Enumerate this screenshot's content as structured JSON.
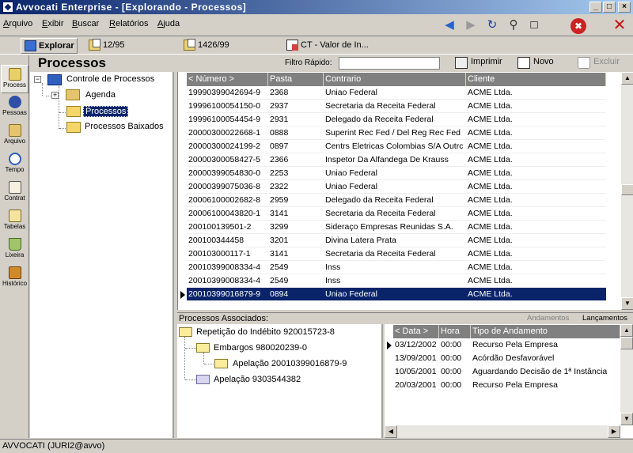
{
  "window": {
    "title": "Avvocati Enterprise - [Explorando - Processos]",
    "controls": [
      "_",
      "□",
      "×"
    ]
  },
  "menu": [
    {
      "label": "Arquivo",
      "u": "A",
      "rest": "rquivo"
    },
    {
      "label": "Exibir",
      "u": "E",
      "rest": "xibir"
    },
    {
      "label": "Buscar",
      "u": "B",
      "rest": "uscar"
    },
    {
      "label": "Relatórios",
      "u": "R",
      "rest": "elatórios"
    },
    {
      "label": "Ajuda",
      "u": "A",
      "rest": "juda"
    }
  ],
  "toolbar_icons": [
    "back-arrow-icon",
    "forward-arrow-icon",
    "refresh-icon",
    "search-icon",
    "new-document-icon",
    "stop-icon",
    "close-icon"
  ],
  "tabs": [
    {
      "label": "Explorar",
      "active": true
    },
    {
      "label": "12/95",
      "active": false
    },
    {
      "label": "1426/99",
      "active": false
    },
    {
      "label": "CT - Valor de In...",
      "active": false
    }
  ],
  "leftnav": [
    {
      "label": "Process",
      "icon": "process-icon",
      "active": true
    },
    {
      "label": "Pessoas",
      "icon": "people-icon",
      "active": false
    },
    {
      "label": "Arquivo",
      "icon": "archive-icon",
      "active": false
    },
    {
      "label": "Tempo",
      "icon": "clock-icon",
      "active": false
    },
    {
      "label": "Contrat",
      "icon": "contract-icon",
      "active": false
    },
    {
      "label": "Tabelas",
      "icon": "table-icon",
      "active": false
    },
    {
      "label": "Lixeira",
      "icon": "trash-icon",
      "active": false
    },
    {
      "label": "Histórico",
      "icon": "history-icon",
      "active": false
    }
  ],
  "panel": {
    "title": "Processos",
    "filter_label": "Filtro Rápido:",
    "filter_value": "",
    "print_label": "Imprimir",
    "new_label": "Novo",
    "delete_label": "Excluir"
  },
  "tree": {
    "root": "Controle de Processos",
    "agenda": "Agenda",
    "processos": "Processos",
    "baixados": "Processos Baixados"
  },
  "grid": {
    "columns": [
      "< Número >",
      "Pasta",
      "Contrario",
      "Cliente"
    ],
    "rows": [
      [
        "19990399042694-9",
        "2368",
        "Uniao Federal",
        "ACME Ltda."
      ],
      [
        "19996100054150-0",
        "2937",
        "Secretaria da Receita Federal",
        "ACME Ltda."
      ],
      [
        "19996100054454-9",
        "2931",
        "Delegado da Receita Federal",
        "ACME Ltda."
      ],
      [
        "20000300022668-1",
        "0888",
        "Superint Rec Fed / Del Reg Rec Fed",
        "ACME Ltda."
      ],
      [
        "20000300024199-2",
        "0897",
        "Centrs Eletricas Colombias S/A Outrc",
        "ACME Ltda."
      ],
      [
        "20000300058427-5",
        "2366",
        "Inspetor Da Alfandega De Krauss",
        "ACME Ltda."
      ],
      [
        "20000399054830-0",
        "2253",
        "Uniao Federal",
        "ACME Ltda."
      ],
      [
        "20000399075036-8",
        "2322",
        "Uniao Federal",
        "ACME Ltda."
      ],
      [
        "20006100002682-8",
        "2959",
        "Delegado da Receita Federal",
        "ACME Ltda."
      ],
      [
        "20006100043820-1",
        "3141",
        "Secretaria da Receita Federal",
        "ACME Ltda."
      ],
      [
        "200100139501-2",
        "3299",
        "Sideraço Empresas Reunidas S.A.",
        "ACME Ltda."
      ],
      [
        "200100344458",
        "3201",
        "Divina Latera Prata",
        "ACME Ltda."
      ],
      [
        "200103000117-1",
        "3141",
        "Secretaria da Receita Federal",
        "ACME Ltda."
      ],
      [
        "20010399008334-4",
        "2549",
        "Inss",
        "ACME Ltda."
      ],
      [
        "20010399008334-4",
        "2549",
        "Inss",
        "ACME Ltda."
      ],
      [
        "20010399016879-9",
        "0894",
        "Uniao Federal",
        "ACME Ltda."
      ]
    ],
    "selected_index": 15
  },
  "associados": {
    "title": "Processos Associados:",
    "tab_andamentos": "Andamentos",
    "tab_lancamentos": "Lançamentos",
    "tree": [
      {
        "label": "Repetição do Indébito 920015723-8",
        "level": 0
      },
      {
        "label": "Embargos 980020239-0",
        "level": 1
      },
      {
        "label": "Apelação 20010399016879-9",
        "level": 2
      },
      {
        "label": "Apelação 9303544382",
        "level": 1
      }
    ]
  },
  "andamentos": {
    "columns": [
      "< Data >",
      "Hora",
      "Tipo de Andamento"
    ],
    "rows": [
      [
        "03/12/2002",
        "00:00",
        "Recurso Pela Empresa"
      ],
      [
        "13/09/2001",
        "00:00",
        "Acórdão Desfavorável"
      ],
      [
        "10/05/2001",
        "00:00",
        "Aguardando Decisão de 1ª Instância"
      ],
      [
        "20/03/2001",
        "00:00",
        "Recurso Pela Empresa"
      ]
    ]
  },
  "status": "AVVOCATI (JURI2@avvo)"
}
